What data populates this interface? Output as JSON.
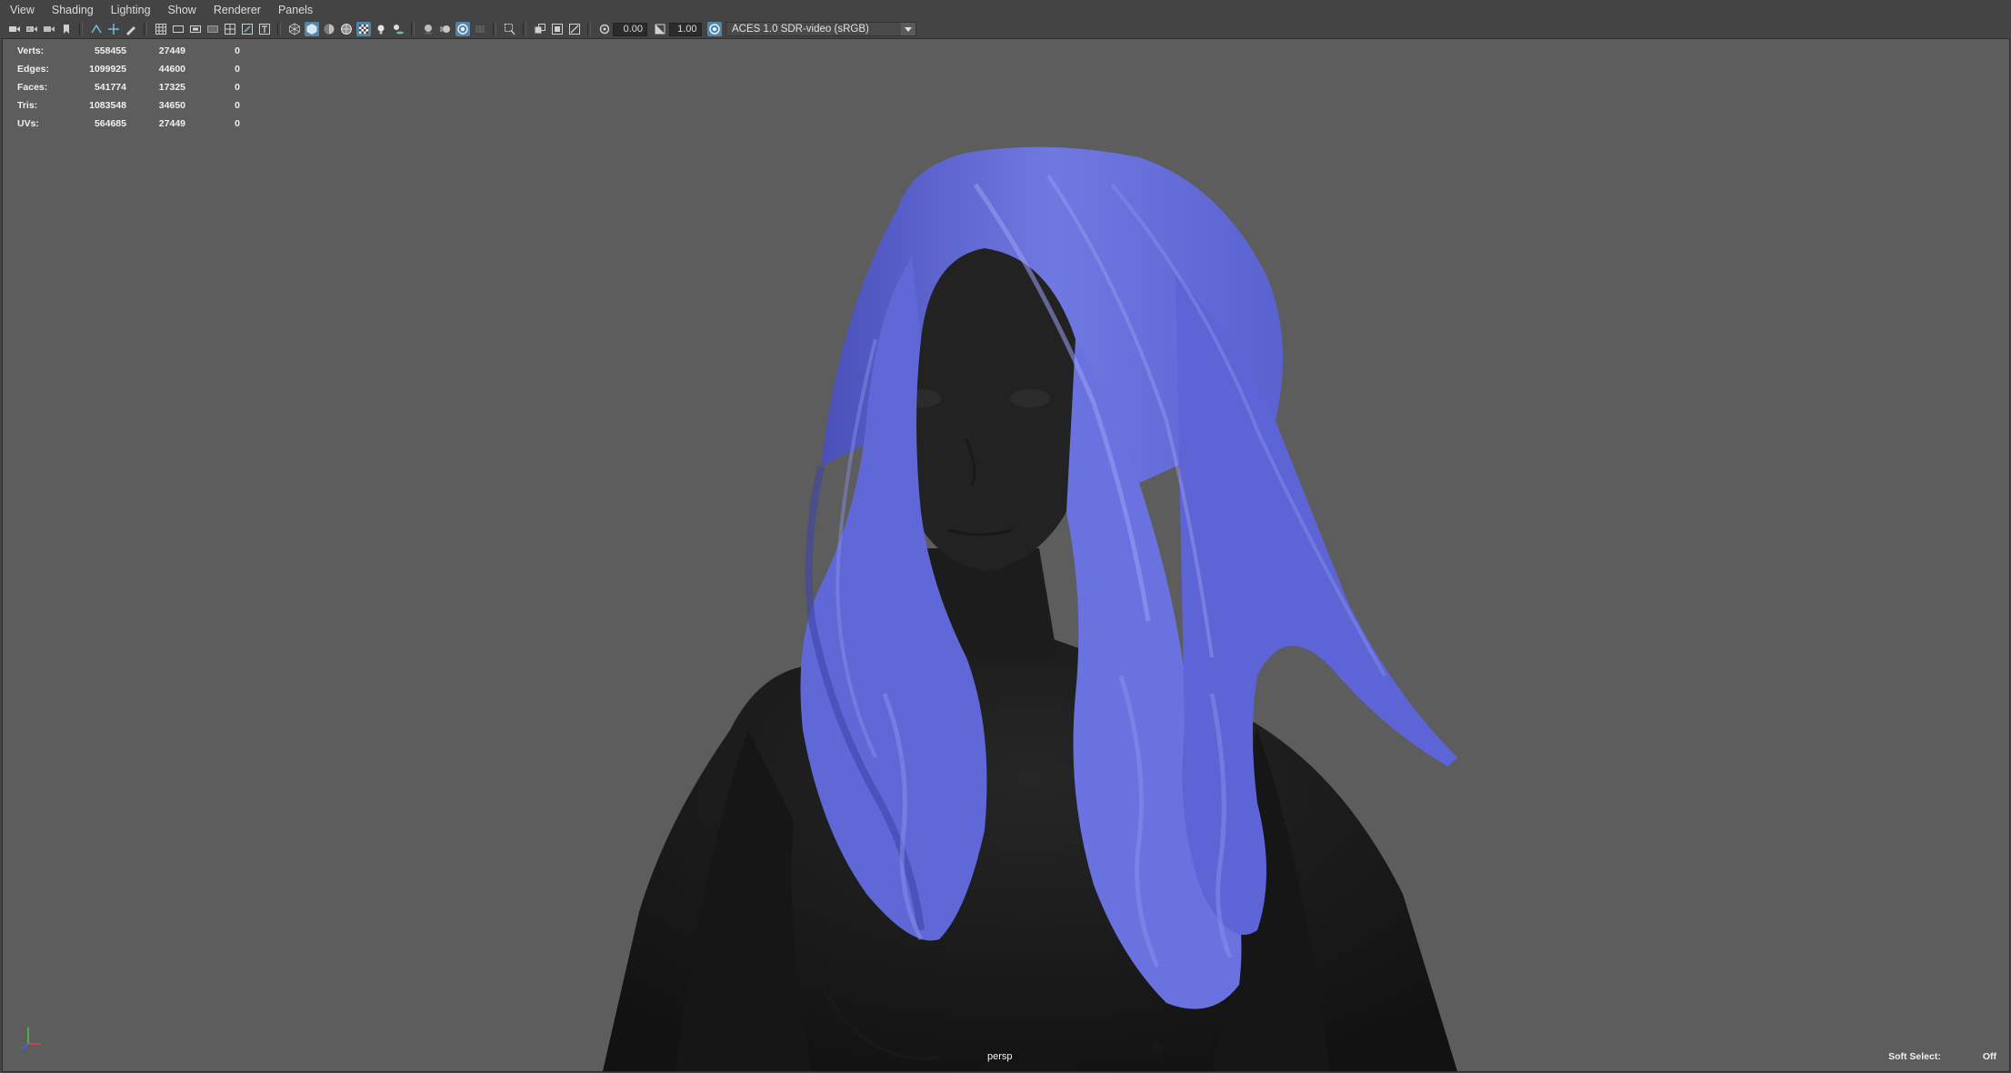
{
  "menubar": {
    "items": [
      "View",
      "Shading",
      "Lighting",
      "Show",
      "Renderer",
      "Panels"
    ]
  },
  "toolbar": {
    "icons": [
      "camera-icon",
      "camera-lock-icon",
      "camera-attributes-icon",
      "bookmark-icon",
      "image-plane-icon",
      "2d-pan-zoom-icon",
      "grease-pencil-icon",
      "grid-icon",
      "film-gate-icon",
      "resolution-gate-icon",
      "gate-mask-icon",
      "field-chart-icon",
      "safe-action-icon",
      "safe-title-icon",
      "wireframe-icon",
      "smooth-shade-icon",
      "default-material-icon",
      "wireframe-on-shaded-icon",
      "textured-icon",
      "use-lights-icon",
      "shadows-icon",
      "screen-space-ao-icon",
      "motion-blur-icon",
      "anti-aliasing-icon",
      "depth-of-field-icon",
      "isolate-select-icon",
      "xray-icon",
      "xray-active-icon",
      "xray-joints-icon",
      "exposure-icon",
      "gamma-icon",
      "color-management-icon"
    ],
    "exposure_value": "0.00",
    "gamma_value": "1.00",
    "view_transform": "ACES 1.0 SDR-video (sRGB)"
  },
  "hud": {
    "rows": [
      {
        "label": "Verts:",
        "v1": "558455",
        "v2": "27449",
        "v3": "0"
      },
      {
        "label": "Edges:",
        "v1": "1099925",
        "v2": "44600",
        "v3": "0"
      },
      {
        "label": "Faces:",
        "v1": "541774",
        "v2": "17325",
        "v3": "0"
      },
      {
        "label": "Tris:",
        "v1": "1083548",
        "v2": "34650",
        "v3": "0"
      },
      {
        "label": "UVs:",
        "v1": "564685",
        "v2": "27449",
        "v3": "0"
      }
    ]
  },
  "viewport": {
    "camera": "persp",
    "soft_select_label": "Soft Select:",
    "soft_select_value": "Off"
  },
  "colors": {
    "hair": "#6b74e0",
    "body": "#1e1e1e",
    "viewport_bg": "#5d5d5d",
    "active_icon": "#5285a6"
  }
}
